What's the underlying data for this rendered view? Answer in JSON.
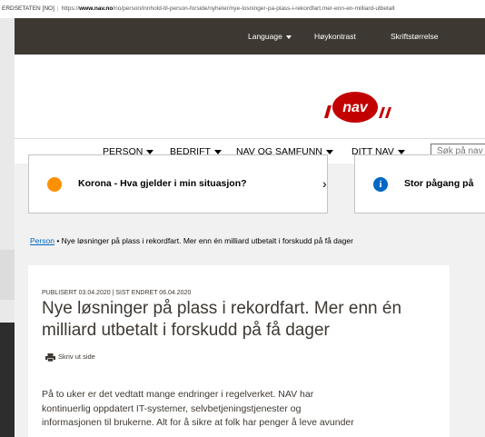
{
  "browser": {
    "site_identity": "ERDSETATEN [NO]",
    "url_prefix": "https://",
    "url_domain": "www.nav.no",
    "url_path": "/no/person/innhold-til-person-forside/nyheter/nye-losninger-pa-plass-i-rekordfart.mer-enn-en-milliard-utbetalt"
  },
  "topbar": {
    "language": "Language",
    "contrast": "Høykontrast",
    "font_size": "Skriftstørrelse"
  },
  "logo": {
    "text": "nav"
  },
  "nav": {
    "items": [
      {
        "label": "PERSON"
      },
      {
        "label": "BEDRIFT"
      },
      {
        "label": "NAV OG SAMFUNN"
      },
      {
        "label": "DITT NAV"
      }
    ],
    "search_placeholder": "Søk på nav"
  },
  "alerts": [
    {
      "text": "Korona - Hva gjelder i min situasjon?",
      "icon": "orange-dot-icon",
      "color": "#ff9100"
    },
    {
      "text": "Stor pågang på",
      "icon": "info-icon",
      "color": "#0067c5"
    }
  ],
  "breadcrumb": {
    "link": "Person",
    "current": "Nye løsninger på plass i rekordfart. Mer enn én milliard utbetalt i forskudd på få dager"
  },
  "article": {
    "meta": "PUBLISERT 03.04.2020 | SIST ENDRET 06.04.2020",
    "title_line1": "Nye løsninger på plass i rekordfart. Mer enn én",
    "title_line2": "milliard utbetalt i forskudd på få dager",
    "print_label": "Skriv ut side",
    "body_lines": [
      "På to uker er det vedtatt mange endringer i regelverket. NAV har",
      "kontinuerlig oppdatert IT-systemer, selvbetjeningstjenester og",
      "informasjonen til brukerne. Alt for å sikre at folk har penger å leve avunder"
    ]
  },
  "colors": {
    "nav_red": "#c30000",
    "topbar": "#3e3832",
    "link": "#0067c5"
  }
}
